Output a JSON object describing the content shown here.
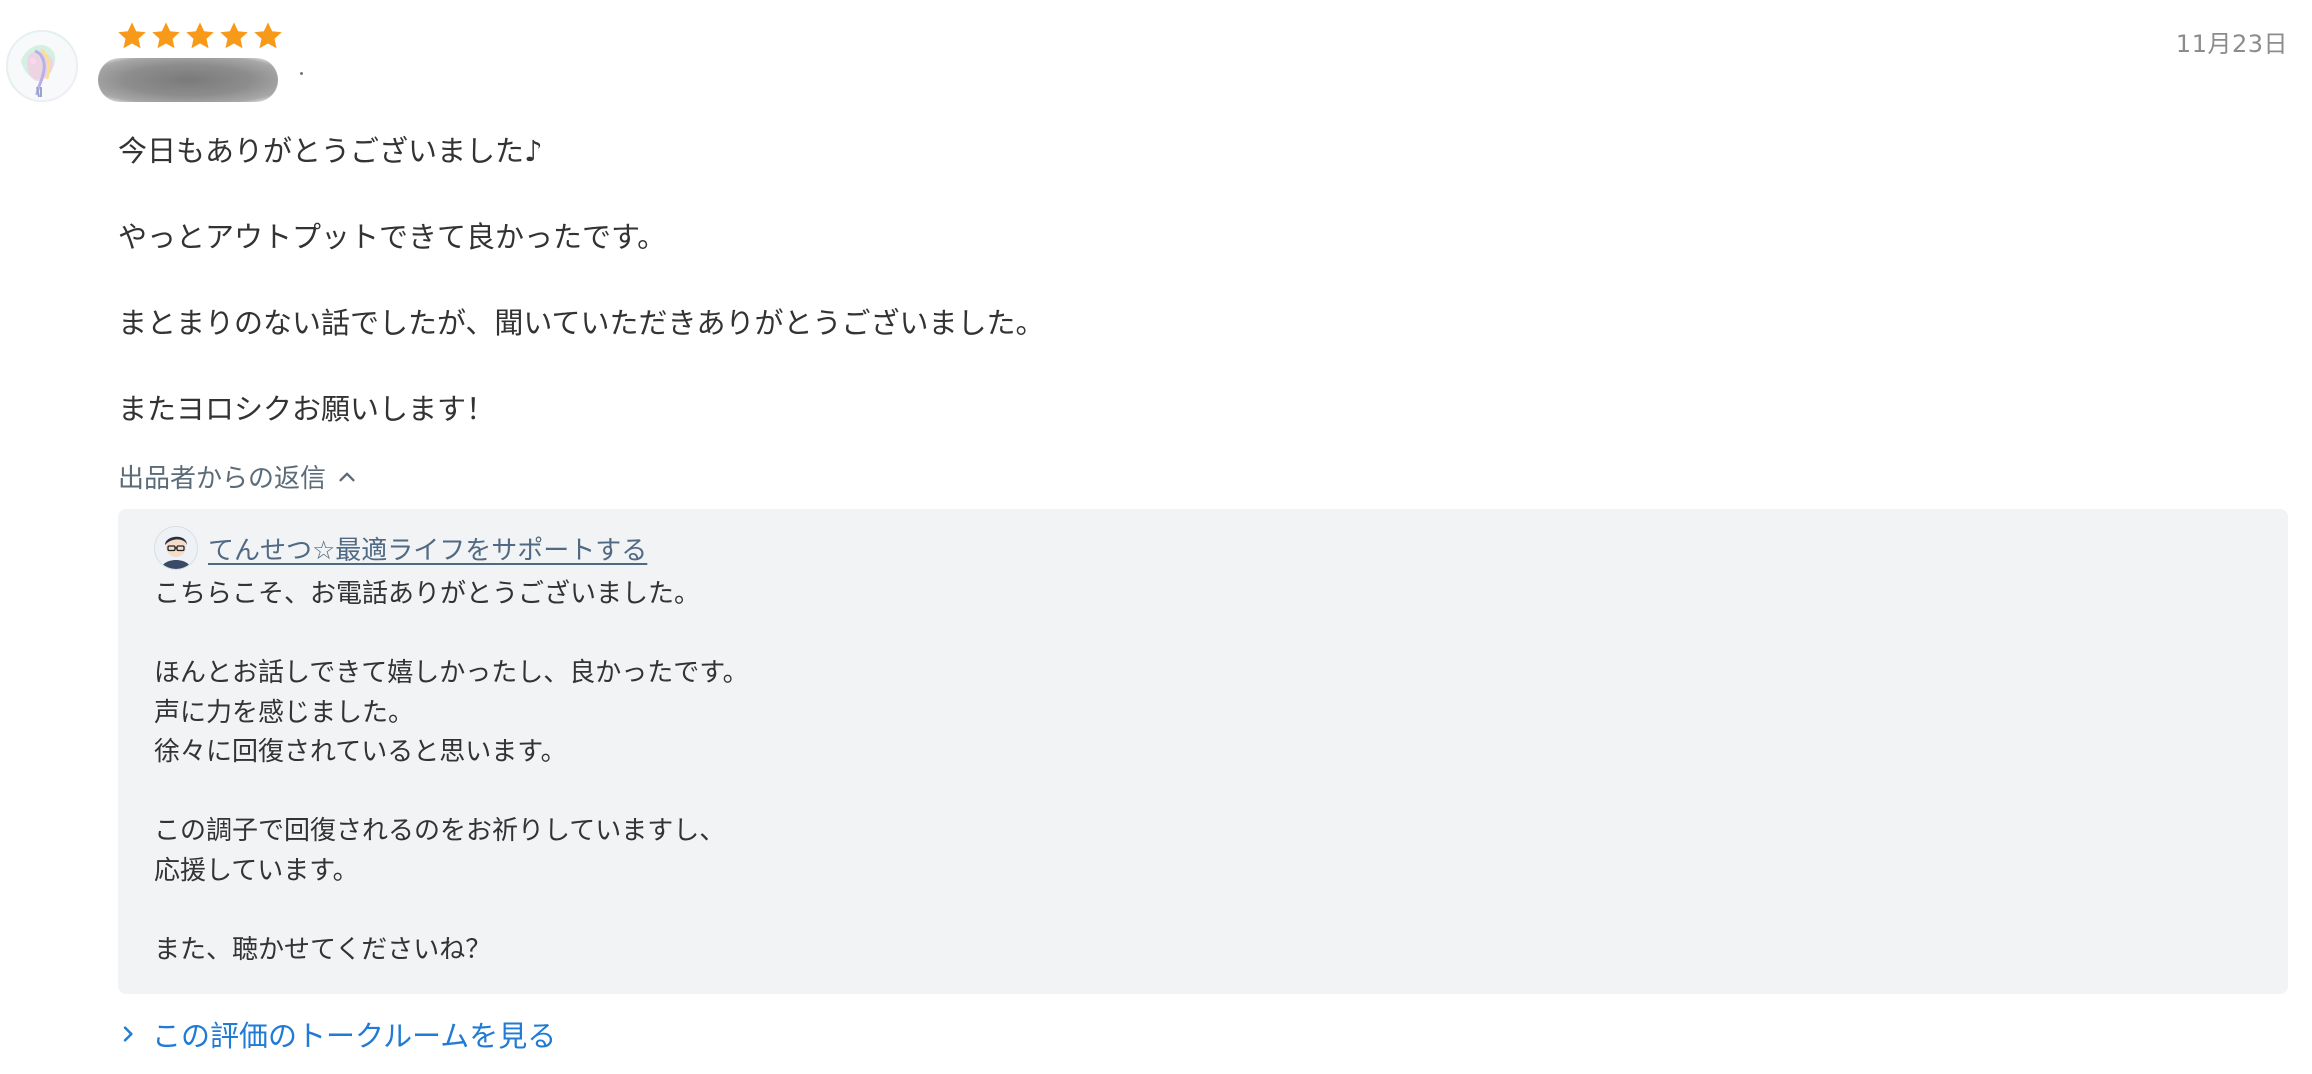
{
  "review": {
    "rating": 5,
    "date": "11月23日",
    "colors": {
      "star": "#f79a19",
      "link": "#1f7bd4",
      "seller_name": "#4f6a82",
      "reply_background": "#f2f3f5"
    },
    "body": [
      "今日もありがとうございました♪",
      "やっとアウトプットできて良かったです。",
      "まとまりのない話でしたが、聞いていただきありがとうございました。",
      "またヨロシクお願いします！"
    ]
  },
  "reply": {
    "toggle_label": "出品者からの返信",
    "toggle_icon": "chevron-up-icon",
    "seller_name": "てんせつ☆最適ライフをサポートする",
    "paragraphs": [
      "こちらこそ、お電話ありがとうございました。",
      "ほんとお話しできて嬉しかったし、良かったです。\n声に力を感じました。\n徐々に回復されていると思います。",
      "この調子で回復されるのをお祈りしていますし、\n応援しています。",
      "また、聴かせてくださいね？"
    ]
  },
  "talkroom_link": {
    "label": "この評価のトークルームを見る",
    "icon": "chevron-right-icon"
  }
}
